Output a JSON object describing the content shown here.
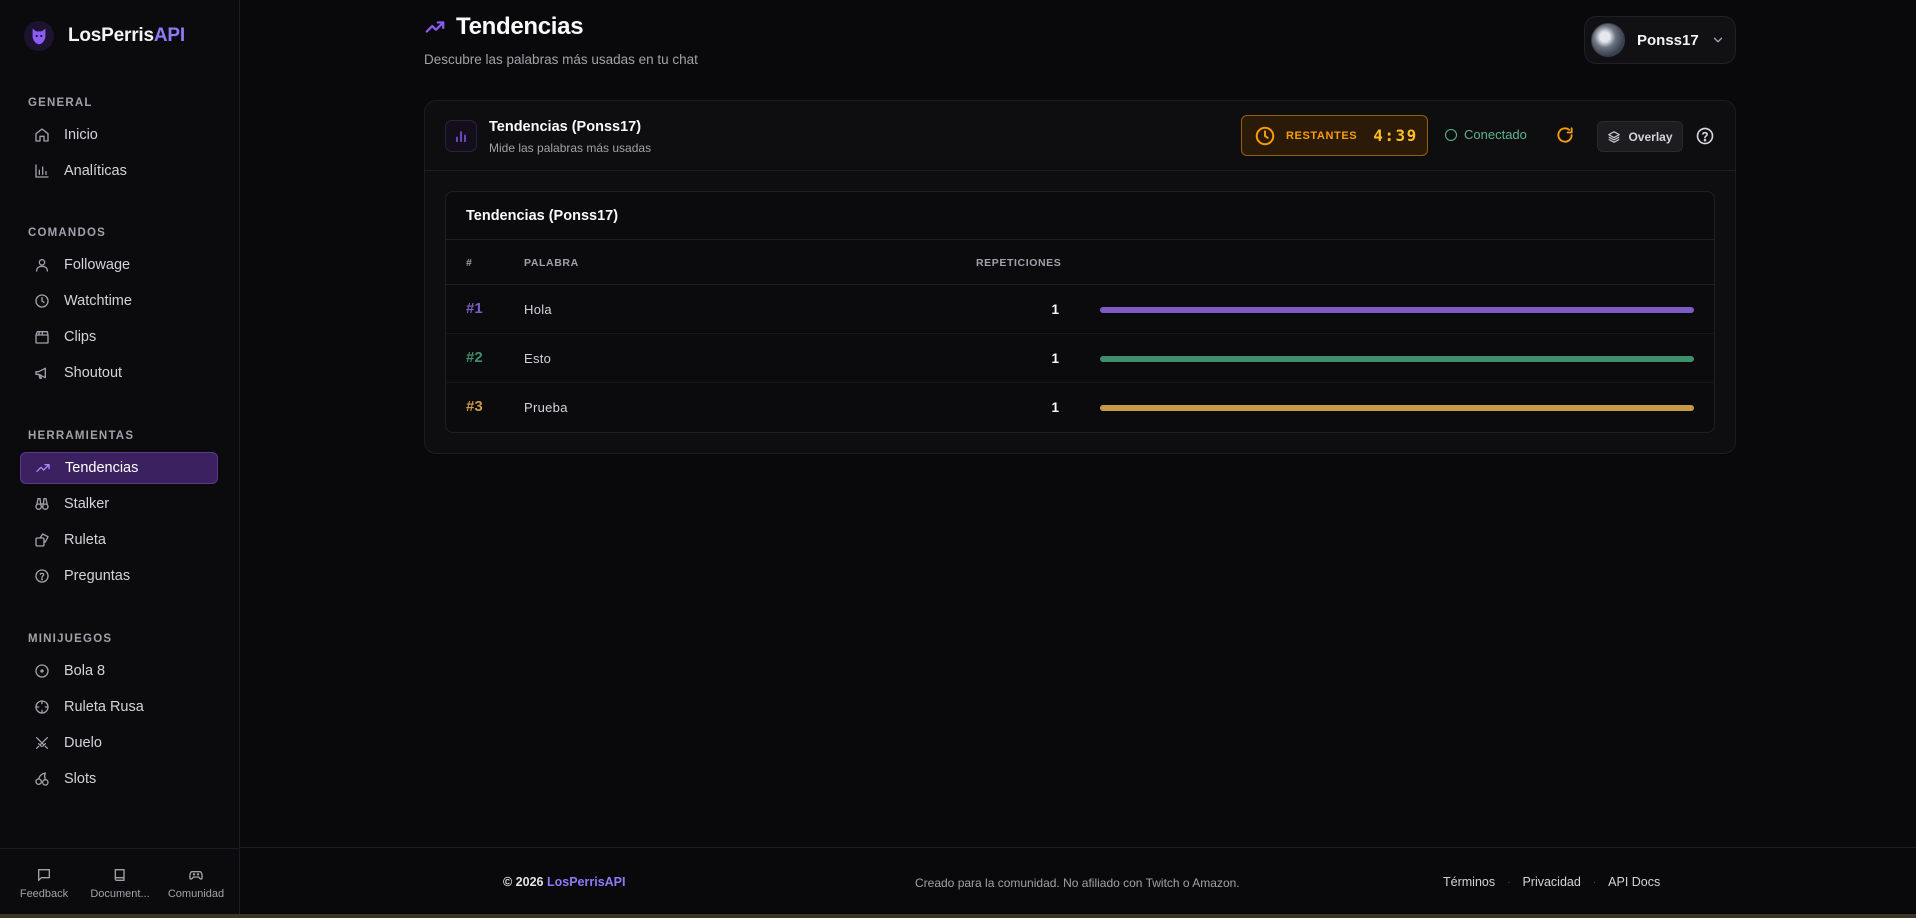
{
  "brand": {
    "name_main": "LosPerris",
    "name_accent": "API"
  },
  "sidebar": {
    "sections": [
      {
        "heading": "GENERAL",
        "items": [
          {
            "label": "Inicio",
            "icon": "home-icon"
          },
          {
            "label": "Analíticas",
            "icon": "bar-chart-icon"
          }
        ]
      },
      {
        "heading": "COMANDOS",
        "items": [
          {
            "label": "Followage",
            "icon": "user-icon"
          },
          {
            "label": "Watchtime",
            "icon": "clock-icon"
          },
          {
            "label": "Clips",
            "icon": "clapperboard-icon"
          },
          {
            "label": "Shoutout",
            "icon": "megaphone-icon"
          }
        ]
      },
      {
        "heading": "HERRAMIENTAS",
        "items": [
          {
            "label": "Tendencias",
            "icon": "trending-up-icon",
            "active": true
          },
          {
            "label": "Stalker",
            "icon": "binoculars-icon"
          },
          {
            "label": "Ruleta",
            "icon": "dice-icon"
          },
          {
            "label": "Preguntas",
            "icon": "help-circle-icon"
          }
        ]
      },
      {
        "heading": "MINIJUEGOS",
        "items": [
          {
            "label": "Bola 8",
            "icon": "circle-dot-icon"
          },
          {
            "label": "Ruleta Rusa",
            "icon": "crosshair-icon"
          },
          {
            "label": "Duelo",
            "icon": "swords-icon"
          },
          {
            "label": "Slots",
            "icon": "cherry-icon"
          }
        ]
      }
    ],
    "bottom": [
      {
        "label": "Feedback",
        "icon": "message-icon"
      },
      {
        "label": "Document...",
        "icon": "book-icon"
      },
      {
        "label": "Comunidad",
        "icon": "gamepad-icon"
      }
    ]
  },
  "header": {
    "title": "Tendencias",
    "subtitle": "Descubre las palabras más usadas en tu chat",
    "user": "Ponss17"
  },
  "card": {
    "title": "Tendencias (Ponss17)",
    "subtitle": "Mide las palabras más usadas",
    "timer_label": "RESTANTES",
    "timer_value": "4:39",
    "status": "Conectado",
    "overlay_label": "Overlay"
  },
  "table": {
    "title": "Tendencias (Ponss17)",
    "columns": {
      "rank": "#",
      "word": "PALABRA",
      "reps": "REPETICIONES"
    },
    "rows": [
      {
        "rank": "#1",
        "word": "Hola",
        "count": "1",
        "fraction": 1.0,
        "color": "#7c5cc4"
      },
      {
        "rank": "#2",
        "word": "Esto",
        "count": "1",
        "fraction": 1.0,
        "color": "#3f8f6a"
      },
      {
        "rank": "#3",
        "word": "Prueba",
        "count": "1",
        "fraction": 1.0,
        "color": "#c79a45"
      }
    ]
  },
  "colors": {
    "accent": "#8b7cf6",
    "rank1": "#7c5cc4",
    "rank2": "#3f8f6a",
    "rank3": "#c79a45",
    "timer": "#f59e0b",
    "connected": "#5fb58a"
  },
  "footer": {
    "copyright_prefix": "© 2026",
    "copyright_brand": "LosPerrisAPI",
    "credit": "Creado para la comunidad. No afiliado con Twitch o Amazon.",
    "links": [
      "Términos",
      "Privacidad",
      "API Docs"
    ]
  }
}
